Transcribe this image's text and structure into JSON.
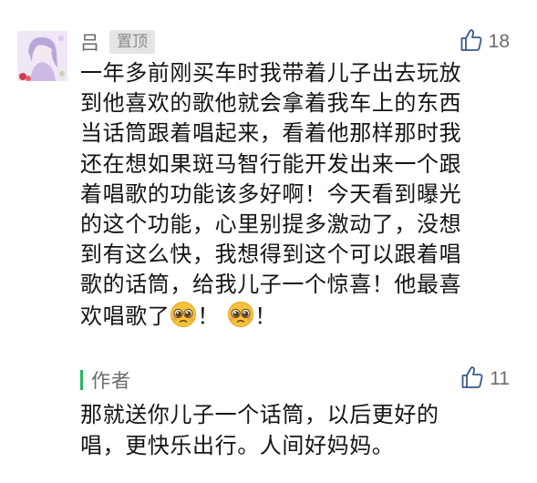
{
  "comment": {
    "author": "吕",
    "badge": "置顶",
    "like_count": "18",
    "lines": [
      "一年多前刚买车时我带着儿子出去玩放",
      "到他喜欢的歌他就会拿着我车上的东西",
      "当话筒跟着唱起来，看着他那样那时我",
      "还在想如果斑马智行能开发出来一个跟",
      "着唱歌的功能该多好啊！今天看到曝光",
      "的这个功能，心里别提多激动了，没想",
      "到有这么快，我想得到这个可以跟着唱",
      "歌的话筒，给我儿子一个惊喜！他最喜"
    ],
    "last_line_start": "欢唱歌了",
    "last_line_sep": "！",
    "last_line_end": "！"
  },
  "reply": {
    "author": "作者",
    "like_count": "11",
    "lines": [
      "那就送你儿子一个话筒，以后更好的",
      "唱，更快乐出行。人间好妈妈。"
    ]
  },
  "icons": {
    "like": "thumbs-up-icon",
    "emoji": "pleading-face-emoji-icon"
  },
  "colors": {
    "text": "#141414",
    "secondary": "#6b6b6b",
    "badge_bg": "#e4e4e4",
    "accent_bar": "#25b864"
  }
}
